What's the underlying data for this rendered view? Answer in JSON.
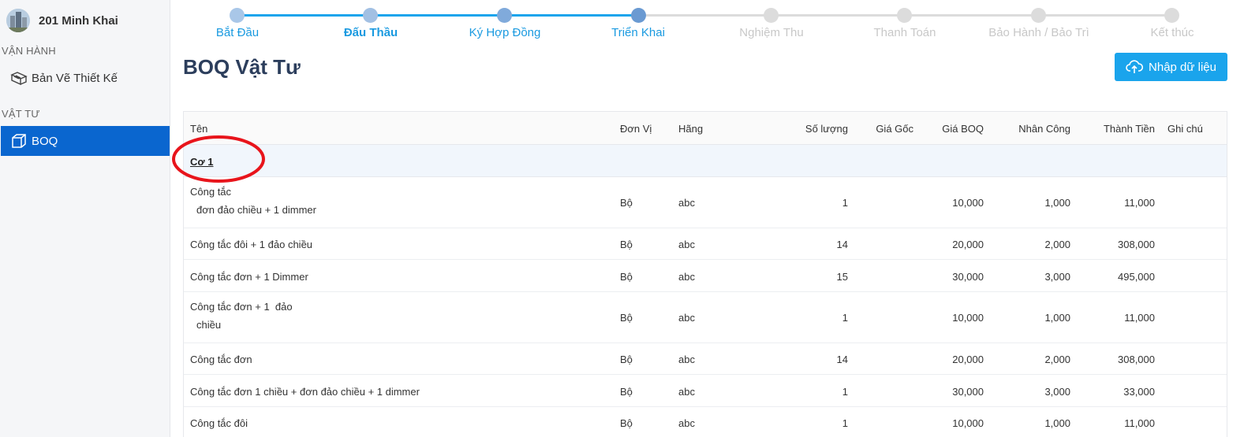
{
  "sidebar": {
    "project_name": "201 Minh Khai",
    "sections": [
      {
        "label": "VẬN HÀNH",
        "items": [
          {
            "label": "Bản Vẽ Thiết Kế",
            "icon": "blueprint-icon"
          }
        ]
      },
      {
        "label": "VẬT TƯ",
        "items": [
          {
            "label": "BOQ",
            "icon": "box-icon",
            "active": true
          }
        ]
      }
    ]
  },
  "stepper": {
    "steps": [
      {
        "label": "Bắt Đầu",
        "state": "done"
      },
      {
        "label": "Đấu Thầu",
        "state": "current"
      },
      {
        "label": "Ký Hợp Đồng",
        "state": "done"
      },
      {
        "label": "Triển Khai",
        "state": "done"
      },
      {
        "label": "Nghiệm Thu",
        "state": "pending"
      },
      {
        "label": "Thanh Toán",
        "state": "pending"
      },
      {
        "label": "Bảo Hành / Bảo Trì",
        "state": "pending"
      },
      {
        "label": "Kết thúc",
        "state": "pending"
      }
    ]
  },
  "page": {
    "title": "BOQ Vật Tư",
    "import_button": "Nhập dữ liệu"
  },
  "table": {
    "columns": [
      "Tên",
      "Đơn Vị",
      "Hãng",
      "Số lượng",
      "Giá Gốc",
      "Giá BOQ",
      "Nhân Công",
      "Thành Tiền",
      "Ghi chú"
    ],
    "group": "Cơ 1",
    "rows": [
      {
        "name": [
          "Công tắc",
          "đơn đảo chiều + 1 dimmer"
        ],
        "unit": "Bộ",
        "brand": "abc",
        "qty": "1",
        "base_price": "",
        "boq_price": "10,000",
        "labor": "1,000",
        "total": "11,000",
        "note": ""
      },
      {
        "name": [
          "Công tắc đôi + 1 đảo chiều"
        ],
        "unit": "Bộ",
        "brand": "abc",
        "qty": "14",
        "base_price": "",
        "boq_price": "20,000",
        "labor": "2,000",
        "total": "308,000",
        "note": ""
      },
      {
        "name": [
          "Công tắc đơn + 1 Dimmer"
        ],
        "unit": "Bộ",
        "brand": "abc",
        "qty": "15",
        "base_price": "",
        "boq_price": "30,000",
        "labor": "3,000",
        "total": "495,000",
        "note": ""
      },
      {
        "name": [
          "Công tắc đơn + 1  đảo",
          "chiều"
        ],
        "unit": "Bộ",
        "brand": "abc",
        "qty": "1",
        "base_price": "",
        "boq_price": "10,000",
        "labor": "1,000",
        "total": "11,000",
        "note": ""
      },
      {
        "name": [
          "Công tắc đơn"
        ],
        "unit": "Bộ",
        "brand": "abc",
        "qty": "14",
        "base_price": "",
        "boq_price": "20,000",
        "labor": "2,000",
        "total": "308,000",
        "note": ""
      },
      {
        "name": [
          "Công tắc đơn 1 chiều + đơn đảo chiều + 1 dimmer"
        ],
        "unit": "Bộ",
        "brand": "abc",
        "qty": "1",
        "base_price": "",
        "boq_price": "30,000",
        "labor": "3,000",
        "total": "33,000",
        "note": ""
      },
      {
        "name": [
          "Công tắc đôi"
        ],
        "unit": "Bộ",
        "brand": "abc",
        "qty": "1",
        "base_price": "",
        "boq_price": "10,000",
        "labor": "1,000",
        "total": "11,000",
        "note": ""
      }
    ]
  },
  "colors": {
    "accent": "#1aa4ec",
    "sidebar_active": "#0a66cf",
    "annotation": "#e8141b",
    "step_done_dot": "#a9c7e8",
    "step_current_dot": "#6fa1d8",
    "step_pending": "#dcdcdc"
  }
}
